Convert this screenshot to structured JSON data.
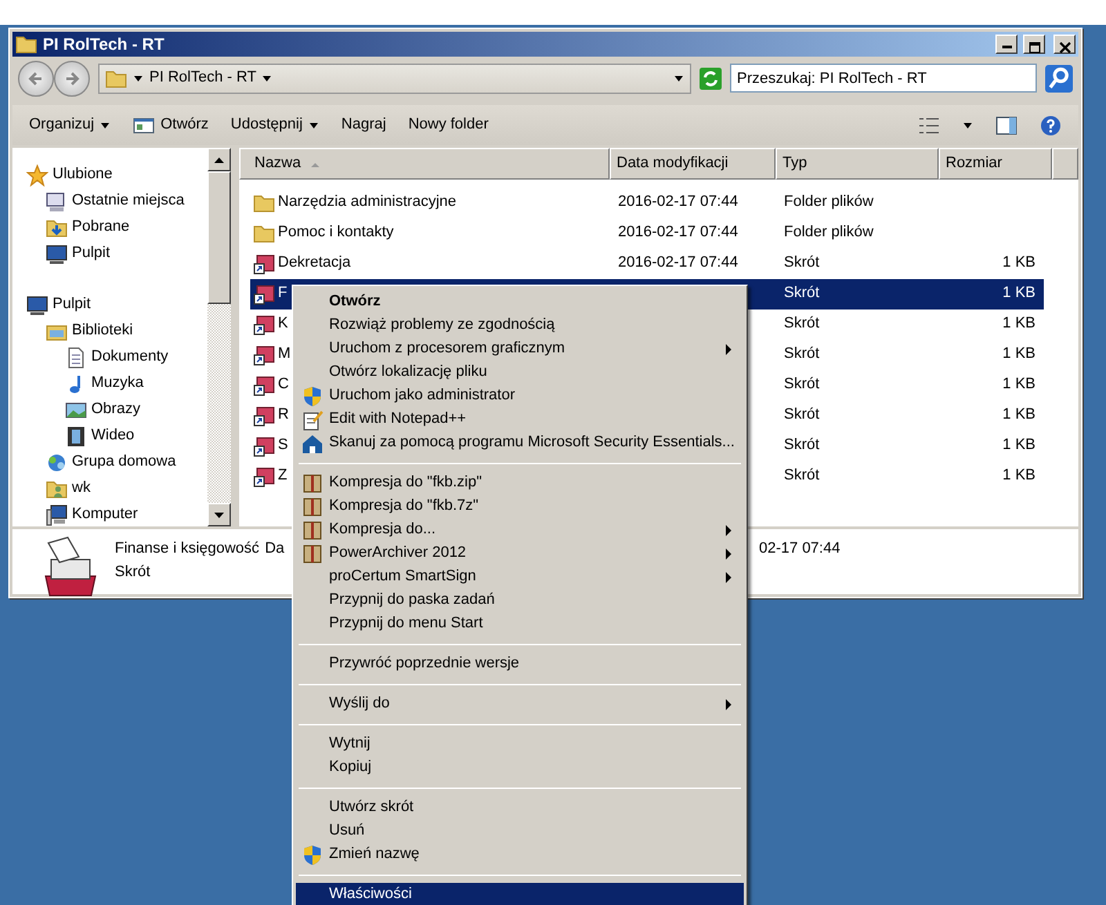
{
  "window": {
    "title": "PI RolTech - RT"
  },
  "address_bar": {
    "path": "PI RolTech - RT",
    "search_placeholder": "Przeszukaj: PI RolTech - RT"
  },
  "toolbar": {
    "items": [
      {
        "label": "Organizuj",
        "dropdown": true,
        "icon": false
      },
      {
        "label": "Otwórz",
        "dropdown": false,
        "icon": true
      },
      {
        "label": "Udostępnij",
        "dropdown": true,
        "icon": false
      },
      {
        "label": "Nagraj",
        "dropdown": false,
        "icon": false
      },
      {
        "label": "Nowy folder",
        "dropdown": false,
        "icon": false
      }
    ]
  },
  "sidebar": {
    "items": [
      {
        "label": "Ulubione",
        "kind": "star",
        "children": [
          {
            "label": "Ostatnie miejsca",
            "kind": "recent"
          },
          {
            "label": "Pobrane",
            "kind": "download"
          },
          {
            "label": "Pulpit",
            "kind": "desktop"
          }
        ]
      },
      {
        "label": "Pulpit",
        "kind": "desktop",
        "children": [
          {
            "label": "Biblioteki",
            "kind": "library",
            "children": [
              {
                "label": "Dokumenty",
                "kind": "document"
              },
              {
                "label": "Muzyka",
                "kind": "music"
              },
              {
                "label": "Obrazy",
                "kind": "picture"
              },
              {
                "label": "Wideo",
                "kind": "video"
              }
            ]
          },
          {
            "label": "Grupa domowa",
            "kind": "network"
          },
          {
            "label": "wk",
            "kind": "user"
          },
          {
            "label": "Komputer",
            "kind": "computer"
          }
        ]
      }
    ]
  },
  "table": {
    "columns": [
      {
        "label": "Nazwa",
        "sorted": true
      },
      {
        "label": "Data modyfikacji",
        "sorted": false
      },
      {
        "label": "Typ",
        "sorted": false
      },
      {
        "label": "Rozmiar",
        "sorted": false
      }
    ],
    "rows": [
      {
        "kind": "folder",
        "name": "Narzędzia administracyjne",
        "date": "2016-02-17 07:44",
        "type": "Folder plików",
        "selected": false
      },
      {
        "kind": "folder",
        "name": "Pomoc i kontakty",
        "date": "2016-02-17 07:44",
        "type": "Folder plików",
        "selected": false
      },
      {
        "kind": "shortcut",
        "name": "Dekretacja",
        "date": "2016-02-17 07:44",
        "type": "Skrót",
        "size": "1 KB",
        "selected": false
      },
      {
        "kind": "shortcut",
        "name": "F",
        "type": "Skrót",
        "size": "1 KB",
        "selected": true
      },
      {
        "kind": "shortcut",
        "name": "K",
        "type": "Skrót",
        "size": "1 KB",
        "selected": false
      },
      {
        "kind": "shortcut",
        "name": "M",
        "type": "Skrót",
        "size": "1 KB",
        "selected": false
      },
      {
        "kind": "shortcut",
        "name": "C",
        "type": "Skrót",
        "size": "1 KB",
        "selected": false
      },
      {
        "kind": "shortcut",
        "name": "R",
        "type": "Skrót",
        "size": "1 KB",
        "selected": false
      },
      {
        "kind": "shortcut",
        "name": "S",
        "type": "Skrót",
        "size": "1 KB",
        "selected": false
      },
      {
        "kind": "shortcut",
        "name": "Z",
        "type": "Skrót",
        "size": "1 KB",
        "selected": false
      }
    ]
  },
  "details_pane": {
    "name": "Finanse i księgowość",
    "field_label": "Da",
    "field_value": "02-17 07:44",
    "type": "Skrót"
  },
  "context_menu": {
    "items": [
      {
        "kind": "plain",
        "label": "Otwórz",
        "default": true,
        "submenu": false,
        "selected": false
      },
      {
        "kind": "plain",
        "label": "Rozwiąż problemy ze zgodnością",
        "default": false,
        "submenu": false,
        "selected": false
      },
      {
        "kind": "plain",
        "label": "Uruchom z procesorem graficznym",
        "default": false,
        "submenu": true,
        "selected": false
      },
      {
        "kind": "plain",
        "label": "Otwórz lokalizację pliku",
        "default": false,
        "submenu": false,
        "selected": false
      },
      {
        "kind": "shield",
        "label": "Uruchom jako administrator",
        "default": false,
        "submenu": false,
        "selected": false
      },
      {
        "kind": "notepad",
        "label": "Edit with Notepad++",
        "default": false,
        "submenu": false,
        "selected": false
      },
      {
        "kind": "scan",
        "label": "Skanuj za pomocą programu Microsoft Security Essentials...",
        "default": false,
        "submenu": false,
        "selected": false
      },
      {
        "kind": "separator"
      },
      {
        "kind": "archive",
        "label": "Kompresja do \"fkb.zip\"",
        "default": false,
        "submenu": false,
        "selected": false
      },
      {
        "kind": "archive",
        "label": "Kompresja do \"fkb.7z\"",
        "default": false,
        "submenu": false,
        "selected": false
      },
      {
        "kind": "archive",
        "label": "Kompresja do...",
        "default": false,
        "submenu": true,
        "selected": false
      },
      {
        "kind": "archive",
        "label": "PowerArchiver 2012",
        "default": false,
        "submenu": true,
        "selected": false
      },
      {
        "kind": "plain",
        "label": "proCertum SmartSign",
        "default": false,
        "submenu": true,
        "selected": false
      },
      {
        "kind": "plain",
        "label": "Przypnij do paska zadań",
        "default": false,
        "submenu": false,
        "selected": false
      },
      {
        "kind": "plain",
        "label": "Przypnij do menu Start",
        "default": false,
        "submenu": false,
        "selected": false
      },
      {
        "kind": "separator"
      },
      {
        "kind": "plain",
        "label": "Przywróć poprzednie wersje",
        "default": false,
        "submenu": false,
        "selected": false
      },
      {
        "kind": "separator"
      },
      {
        "kind": "plain",
        "label": "Wyślij do",
        "default": false,
        "submenu": true,
        "selected": false
      },
      {
        "kind": "separator"
      },
      {
        "kind": "plain",
        "label": "Wytnij",
        "default": false,
        "submenu": false,
        "selected": false
      },
      {
        "kind": "plain",
        "label": "Kopiuj",
        "default": false,
        "submenu": false,
        "selected": false
      },
      {
        "kind": "separator"
      },
      {
        "kind": "plain",
        "label": "Utwórz skrót",
        "default": false,
        "submenu": false,
        "selected": false
      },
      {
        "kind": "plain",
        "label": "Usuń",
        "default": false,
        "submenu": false,
        "selected": false
      },
      {
        "kind": "shield",
        "label": "Zmień nazwę",
        "default": false,
        "submenu": false,
        "selected": false
      },
      {
        "kind": "separator"
      },
      {
        "kind": "plain",
        "label": "Właściwości",
        "default": false,
        "submenu": false,
        "selected": true
      }
    ]
  }
}
